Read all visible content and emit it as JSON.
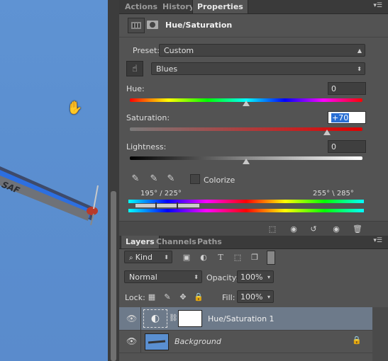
{
  "properties_tabs": [
    "Actions",
    "History",
    "Properties"
  ],
  "adjustment": {
    "title": "Hue/Saturation"
  },
  "preset": {
    "label": "Preset:",
    "value": "Custom"
  },
  "channel": {
    "value": "Blues"
  },
  "hue": {
    "label": "Hue:",
    "value": "0",
    "level": 0
  },
  "saturation": {
    "label": "Saturation:",
    "value": "+70",
    "level": 70
  },
  "lightness": {
    "label": "Lightness:",
    "value": "0",
    "level": 0
  },
  "colorize": {
    "label": "Colorize",
    "checked": false
  },
  "range": {
    "left": "195° / 225°",
    "right": "255° \\ 285°"
  },
  "layers_tabs": [
    "Layers",
    "Channels",
    "Paths"
  ],
  "filter": {
    "value": "Kind"
  },
  "blend": {
    "value": "Normal"
  },
  "opacity": {
    "label": "Opacity:",
    "value": "100%"
  },
  "lock": {
    "label": "Lock:"
  },
  "fill": {
    "label": "Fill:",
    "value": "100%"
  },
  "layers": [
    {
      "name": "Hue/Saturation 1"
    },
    {
      "name": "Background"
    }
  ],
  "canvas_text": "SAF",
  "colors": {
    "panel": "#535353",
    "accent": "#1f6fd0"
  }
}
